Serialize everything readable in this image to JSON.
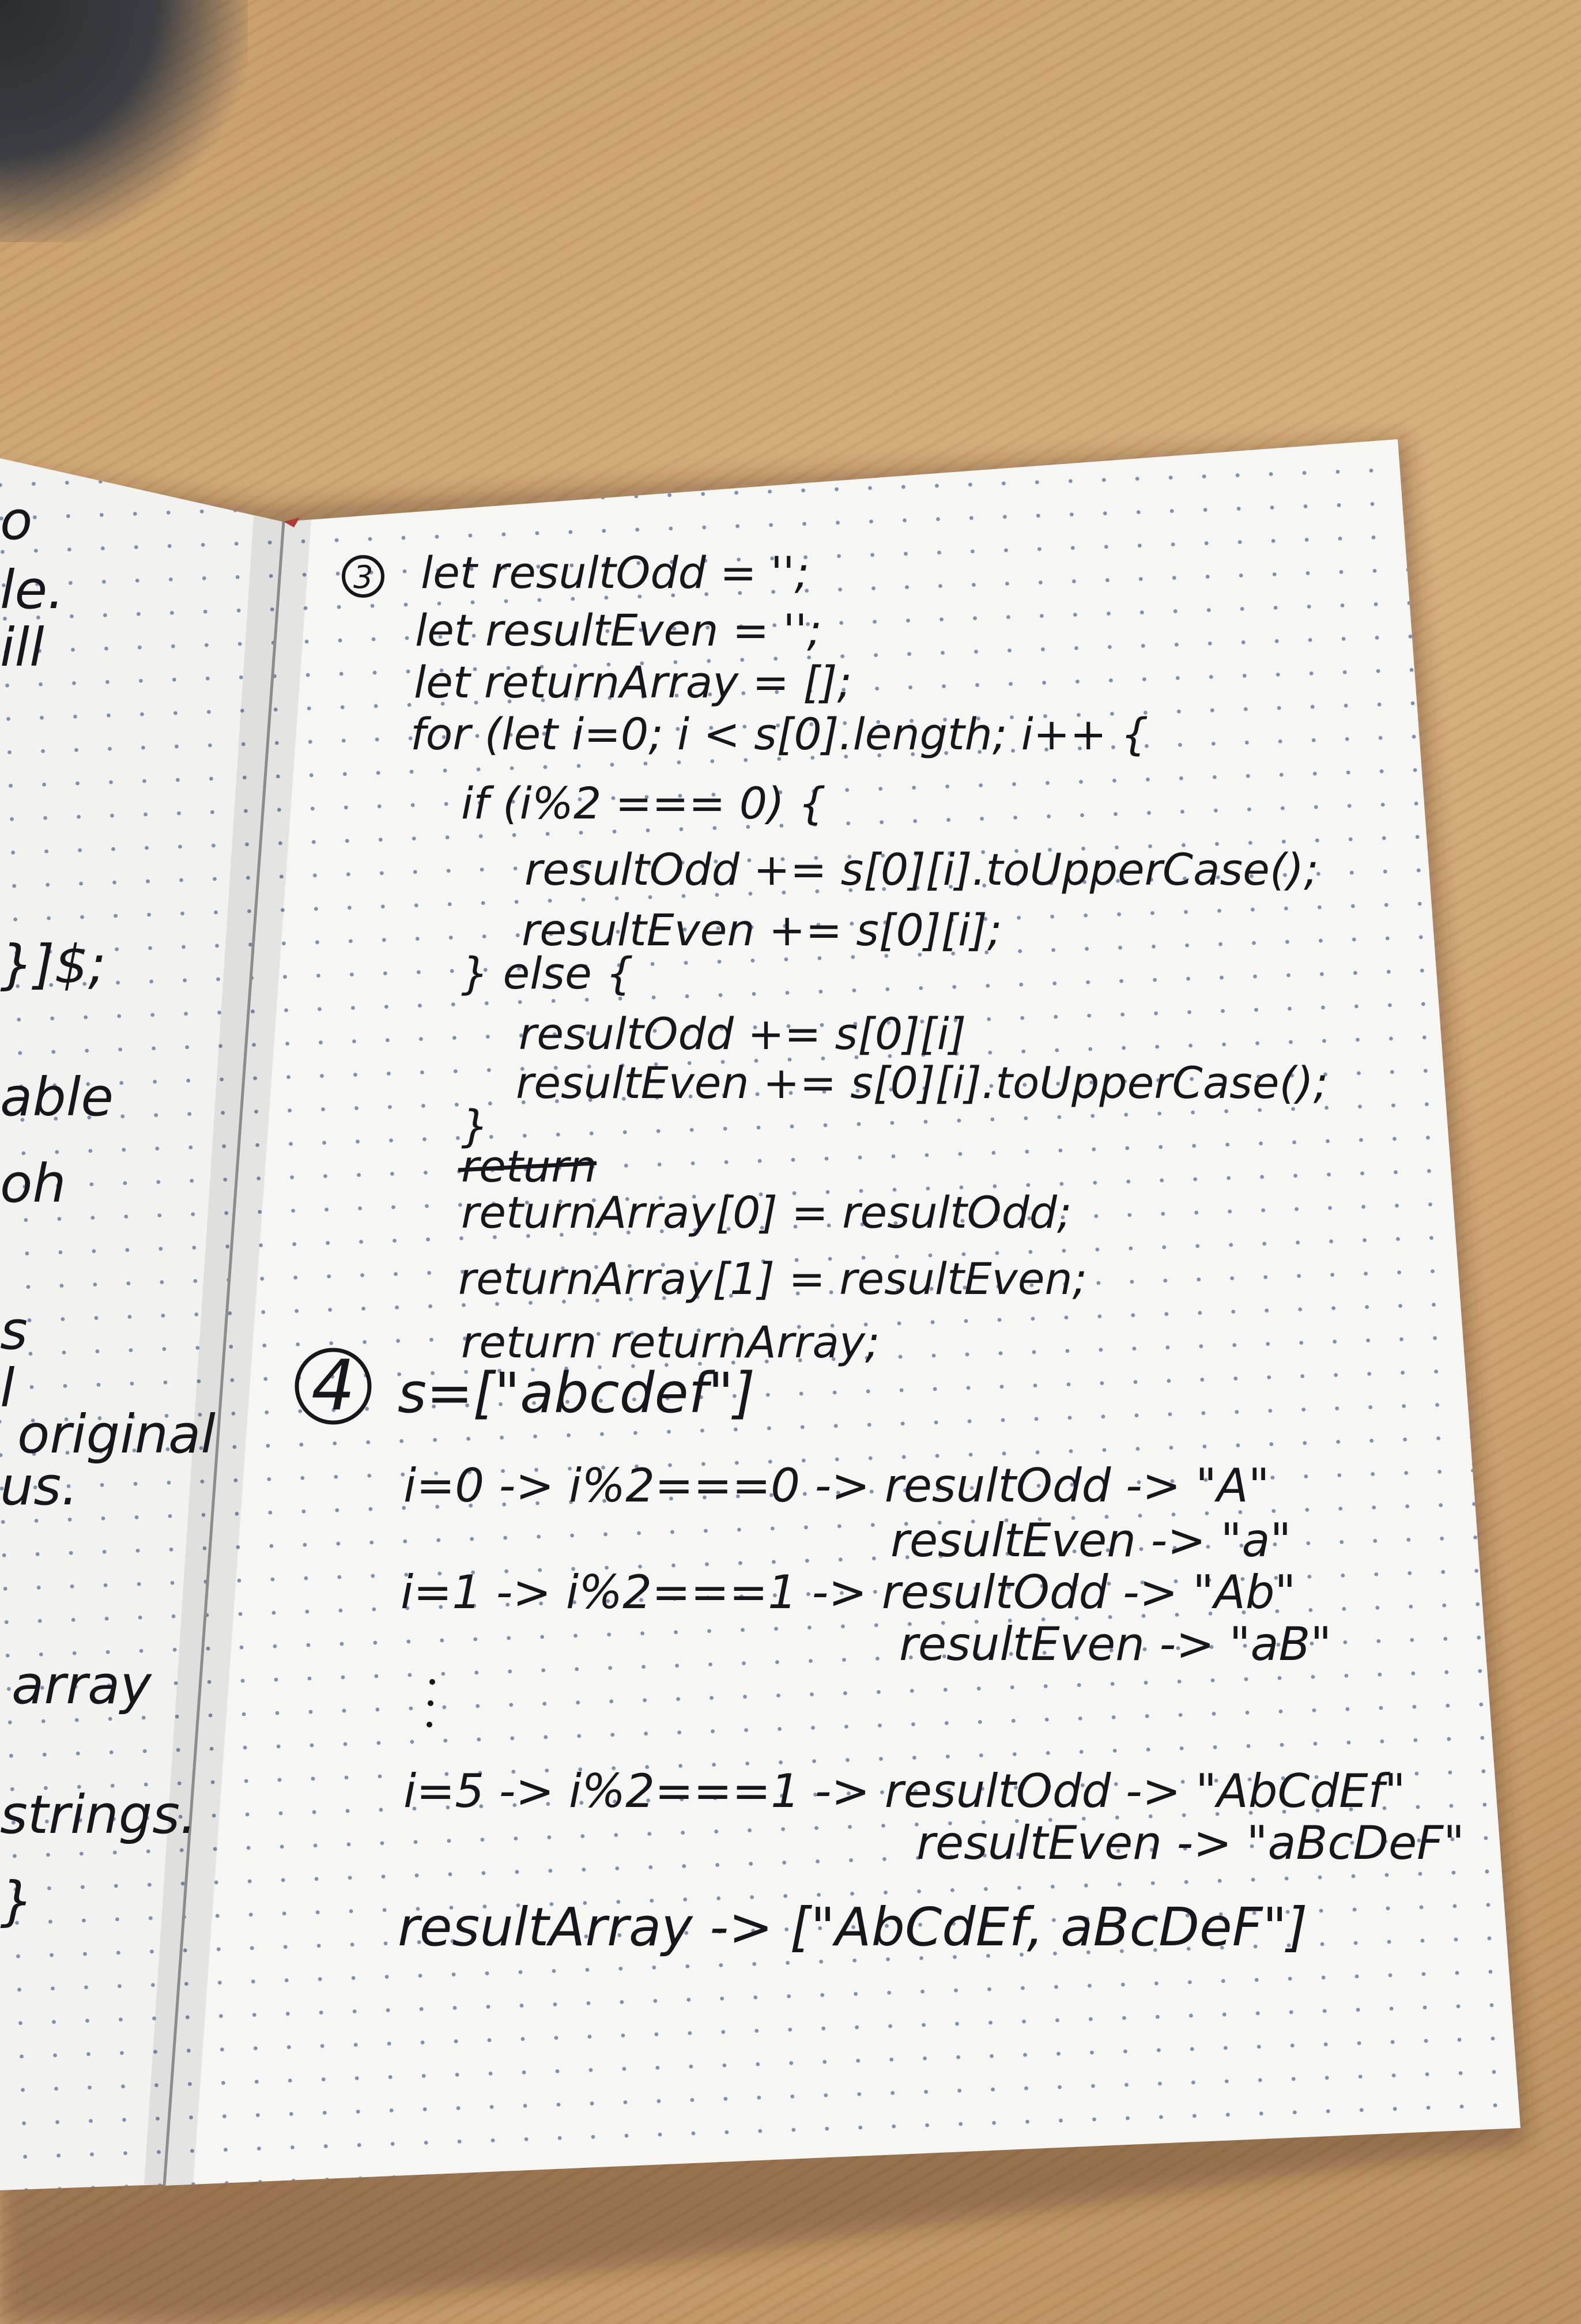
{
  "left_page": {
    "fragments": [
      "o",
      "le.",
      "ill",
      "}]$;",
      "able",
      "oh",
      "s",
      "l",
      "original",
      "us.",
      "array",
      "strings.",
      "}"
    ]
  },
  "problem_3": {
    "number": "3",
    "code_lines": [
      "let resultOdd = '';",
      "let resultEven = '';",
      "let returnArray = [];",
      "for (let i=0; i < s[0].length; i++ {",
      "if (i%2 === 0) {",
      "resultOdd += s[0][i].toUpperCase();",
      "resultEven += s[0][i];",
      "} else {",
      "resultOdd += s[0][i]",
      "resultEven += s[0][i].toUpperCase();",
      "}",
      "return",
      "returnArray[0] = resultOdd;",
      "returnArray[1] = resultEven;",
      "return returnArray;"
    ]
  },
  "problem_4": {
    "number": "4",
    "input": "s=[\"abcdef\"]",
    "trace": [
      "i=0 -> i%2===0 -> resultOdd -> \"A\"",
      "resultEven -> \"a\"",
      "i=1 -> i%2===1 -> resultOdd -> \"Ab\"",
      "resultEven -> \"aB\"",
      "i=5 -> i%2===1 -> resultOdd -> \"AbCdEf\"",
      "resultEven -> \"aBcDeF\"",
      "resultArray -> [\"AbCdEf, aBcDeF\"]"
    ]
  }
}
